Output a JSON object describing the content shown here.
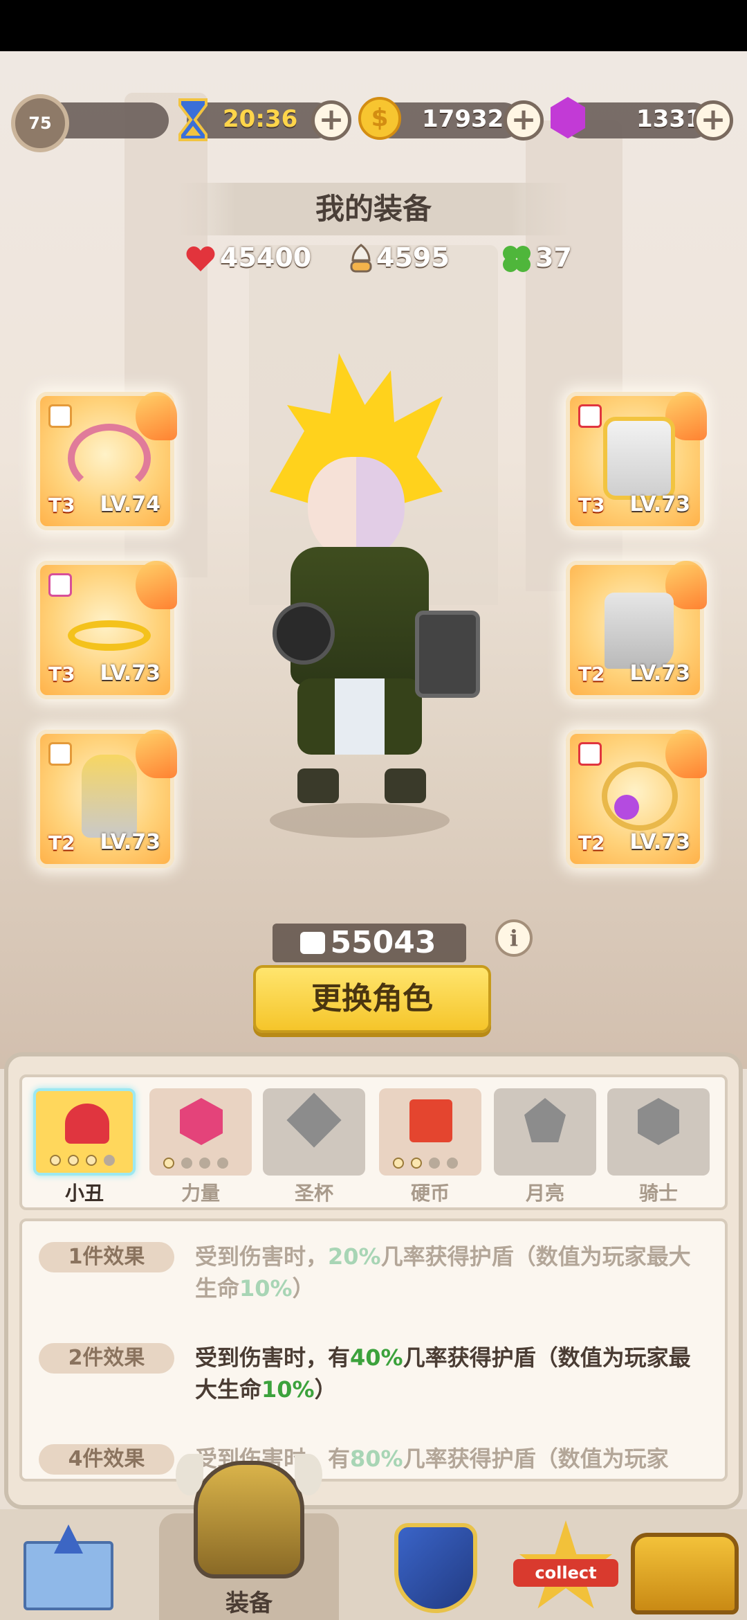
{
  "top_bar": {
    "level": "75",
    "timer": "20:36",
    "coins": "17932",
    "gems": "1331"
  },
  "header": {
    "title": "我的装备",
    "hp": "45400",
    "attack": "4595",
    "luck": "37"
  },
  "equipment": {
    "left": [
      {
        "tier": "T3",
        "level": "LV.74",
        "icon": "bow-icon"
      },
      {
        "tier": "T3",
        "level": "LV.73",
        "icon": "winged-ring-icon"
      },
      {
        "tier": "T2",
        "level": "LV.73",
        "icon": "gauntlet-icon"
      }
    ],
    "right": [
      {
        "tier": "T3",
        "level": "LV.73",
        "icon": "chest-armor-icon"
      },
      {
        "tier": "T2",
        "level": "LV.73",
        "icon": "boots-icon"
      },
      {
        "tier": "T2",
        "level": "LV.73",
        "icon": "amulet-icon"
      }
    ]
  },
  "power": "55043",
  "swap_button": "更换角色",
  "sets": {
    "tabs": [
      {
        "label": "小丑",
        "icon": "clown-icon",
        "color": "#e0353f",
        "lit": 0
      },
      {
        "label": "力量",
        "icon": "strength-icon",
        "color": "#e4437a",
        "lit": 1
      },
      {
        "label": "圣杯",
        "icon": "grail-icon",
        "color": "#8c8c8c",
        "lit": 0
      },
      {
        "label": "硬币",
        "icon": "coin-set-icon",
        "color": "#e4452f",
        "lit": 2
      },
      {
        "label": "月亮",
        "icon": "moon-icon",
        "color": "#8c8c8c",
        "lit": 0
      },
      {
        "label": "骑士",
        "icon": "knight-icon",
        "color": "#8c8c8c",
        "lit": 0
      }
    ],
    "effects": [
      {
        "tag": "1件效果",
        "pre": "受到伤害时，",
        "p1": "20%",
        "mid": "几率获得护盾（数值为玩家最大生命",
        "p2": "10%",
        "post": "）",
        "active": false
      },
      {
        "tag": "2件效果",
        "pre": "受到伤害时，有",
        "p1": "40%",
        "mid": "几率获得护盾（数值为玩家最大生命",
        "p2": "10%",
        "post": "）",
        "active": true
      },
      {
        "tag": "4件效果",
        "pre": "受到伤害时，有",
        "p1": "80%",
        "mid": "几率获得护盾（数值为玩家",
        "p2": "",
        "post": "",
        "active": false
      }
    ]
  },
  "nav": {
    "active_label": "装备",
    "collect_label": "collect"
  }
}
